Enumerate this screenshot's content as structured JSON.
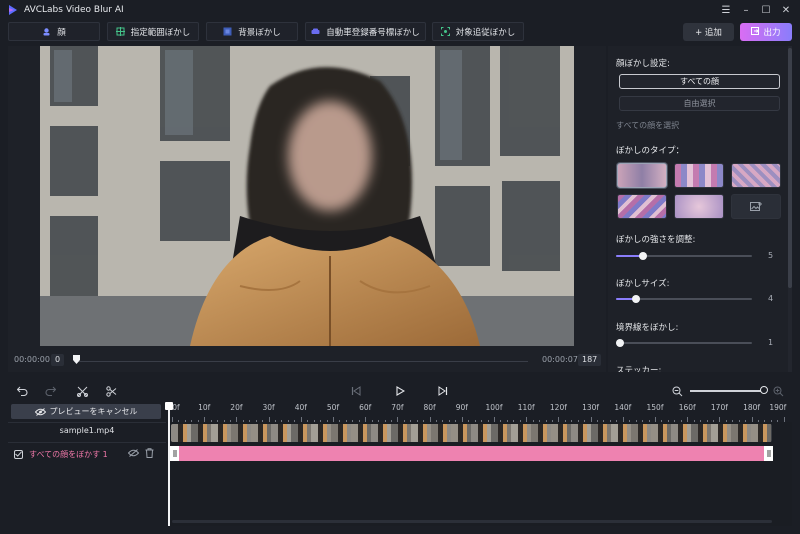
{
  "app": {
    "title": "AVCLabs Video Blur AI"
  },
  "window_controls": {
    "menu": "☰",
    "minimize": "–",
    "maximize": "☐",
    "close": "✕"
  },
  "tabs": [
    {
      "label": "顔"
    },
    {
      "label": "指定範囲ぼかし"
    },
    {
      "label": "背景ぼかし"
    },
    {
      "label": "自動車登録番号標ぼかし"
    },
    {
      "label": "対象追従ぼかし"
    }
  ],
  "actions": {
    "add_label": "+ 追加",
    "export_label": "出力"
  },
  "preview": {
    "time_start": "00:00:00",
    "frame_start": "0",
    "time_end": "00:00:07",
    "frame_end": "187"
  },
  "panel": {
    "face_blur_settings": "顔ぼかし設定:",
    "all_faces": "すべての顔",
    "free_select": "自由選択",
    "select_all_faces": "すべての顔を選択",
    "blur_type": "ぼかしのタイプ：",
    "blur_strength": "ぼかしの強さを調整:",
    "blur_strength_value": "5",
    "blur_strength_fraction": 0.2,
    "blur_size": "ぼかしサイズ:",
    "blur_size_value": "4",
    "blur_size_fraction": 0.15,
    "blur_edge": "境界線をぼかし:",
    "blur_edge_value": "1",
    "blur_edge_fraction": 0.0,
    "sticker": "ステッカー:"
  },
  "timeline": {
    "cancel_preview": "プレビューをキャンセル",
    "file_name": "sample1.mp4",
    "track_label": "すべての顔をぼかす 1",
    "ticks": [
      "0f",
      "10f",
      "20f",
      "30f",
      "40f",
      "50f",
      "60f",
      "70f",
      "80f",
      "90f",
      "100f",
      "110f",
      "120f",
      "130f",
      "140f",
      "150f",
      "160f",
      "170f",
      "180f",
      "190f"
    ]
  },
  "colors": {
    "accent_purple": "#8a7dfb",
    "export_gradient_start": "#d96df3",
    "blur_track_pink": "#ee82b0",
    "track_label_pink": "#f078a9"
  }
}
